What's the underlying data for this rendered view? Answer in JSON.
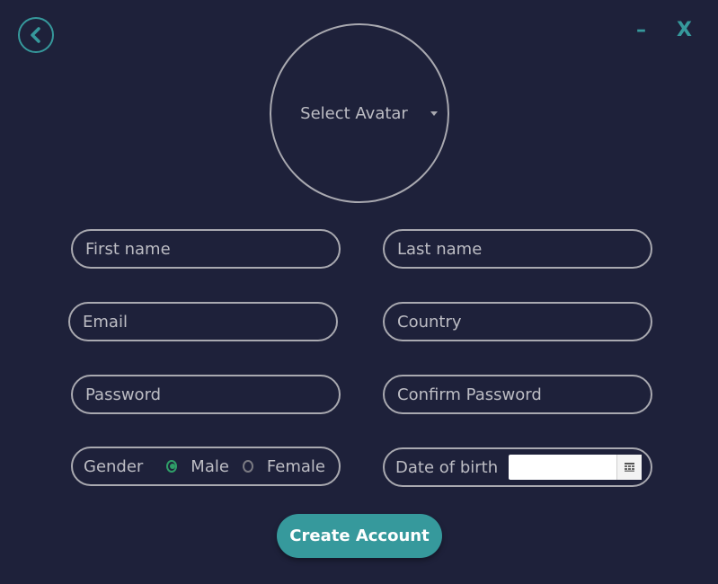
{
  "window": {
    "minimize_label": "–",
    "close_label": "X"
  },
  "avatar": {
    "label": "Select Avatar"
  },
  "fields": {
    "first_name": "First name",
    "last_name": "Last name",
    "email": "Email",
    "country": "Country",
    "password": "Password",
    "confirm_password": "Confirm Password"
  },
  "gender": {
    "label": "Gender",
    "options": [
      "Male",
      "Female"
    ],
    "selected": "Male"
  },
  "dob": {
    "label": "Date of birth",
    "value": ""
  },
  "submit": {
    "label": "Create Account"
  },
  "colors": {
    "background": "#1e213a",
    "accent": "#36999c",
    "radio_selected": "#2f9e68"
  },
  "icons": {
    "back": "chevron-left-icon",
    "calendar": "calendar-icon",
    "dropdown": "caret-down-icon"
  }
}
